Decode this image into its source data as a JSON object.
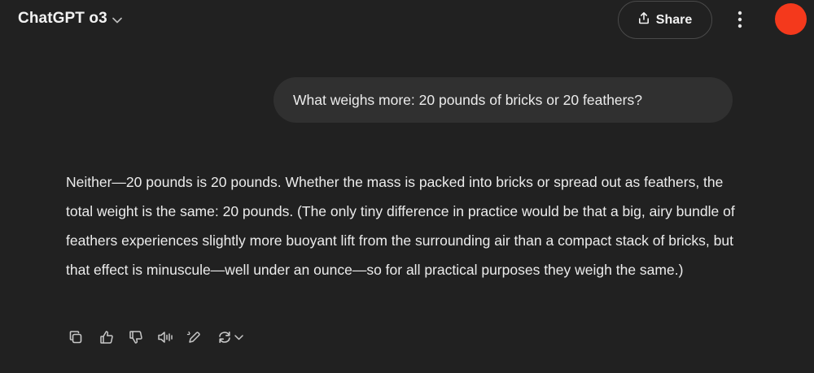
{
  "header": {
    "model_name": "ChatGPT o3",
    "share_label": "Share"
  },
  "conversation": {
    "user_message": "What weighs more: 20 pounds of bricks or 20 feathers?",
    "assistant_message": "Neither—20 pounds is 20 pounds. Whether the mass is packed into bricks or spread out as feathers, the total weight is the same: 20 pounds. (The only tiny difference in practice would be that a big, airy bundle of feathers experiences slightly more buoyant lift from the surrounding air than a compact stack of bricks, but that effect is minuscule—well under an ounce—so for all practical purposes they weigh the same.)"
  },
  "actions": [
    "copy-icon",
    "thumbs-up-icon",
    "thumbs-down-icon",
    "read-aloud-icon",
    "edit-icon",
    "regenerate-icon"
  ],
  "colors": {
    "background": "#212121",
    "bubble": "#303030",
    "avatar": "#f4391c",
    "text": "#ececec"
  }
}
